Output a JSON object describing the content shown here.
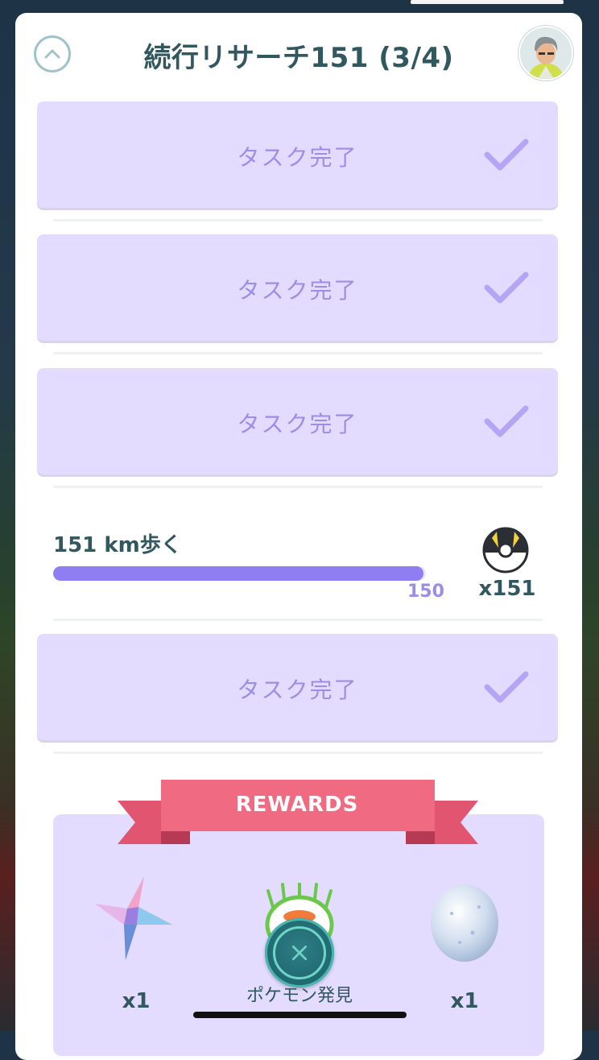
{
  "header": {
    "title": "続行リサーチ151 (3/4)"
  },
  "tasks": [
    {
      "label": "タスク完了"
    },
    {
      "label": "タスク完了"
    },
    {
      "label": "タスク完了"
    },
    {
      "label": "タスク完了"
    }
  ],
  "active_task": {
    "label": "151 km歩く",
    "progress_value": "150",
    "progress_fraction": 0.993,
    "reward_item": "ultra-ball-icon",
    "reward_count": "x151"
  },
  "rewards": {
    "banner": "REWARDS",
    "items": [
      {
        "icon": "stardust-crystal-icon",
        "qty": "x1"
      },
      {
        "icon": "pokemon-encounter-icon",
        "qty": ""
      },
      {
        "icon": "egg-icon",
        "qty": "x1"
      }
    ],
    "encounter_label": "ポケモン発見"
  },
  "colors": {
    "accent": "#8f7ef3",
    "card": "#e3dcff",
    "text": "#31575f",
    "ribbon": "#f0607a"
  }
}
